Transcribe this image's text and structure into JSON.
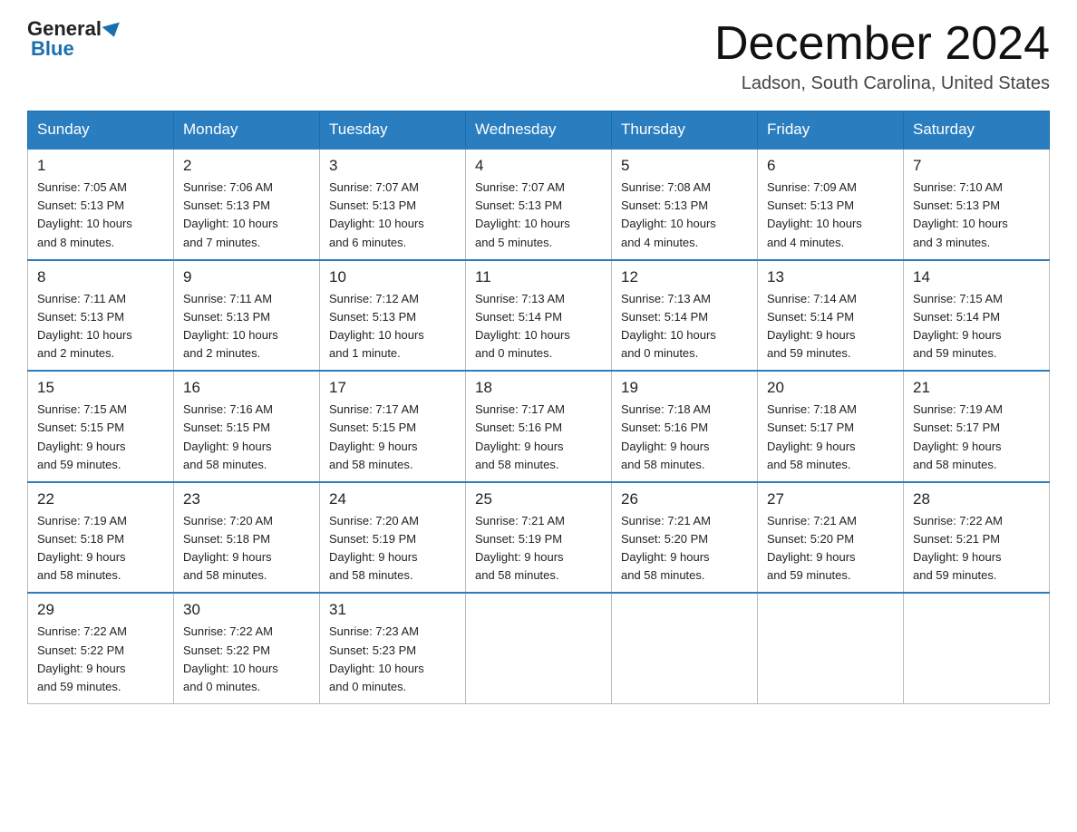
{
  "header": {
    "logo_general": "General",
    "logo_blue": "Blue",
    "month_title": "December 2024",
    "location": "Ladson, South Carolina, United States"
  },
  "days_of_week": [
    "Sunday",
    "Monday",
    "Tuesday",
    "Wednesday",
    "Thursday",
    "Friday",
    "Saturday"
  ],
  "weeks": [
    [
      {
        "day": "1",
        "sunrise": "7:05 AM",
        "sunset": "5:13 PM",
        "daylight": "10 hours and 8 minutes."
      },
      {
        "day": "2",
        "sunrise": "7:06 AM",
        "sunset": "5:13 PM",
        "daylight": "10 hours and 7 minutes."
      },
      {
        "day": "3",
        "sunrise": "7:07 AM",
        "sunset": "5:13 PM",
        "daylight": "10 hours and 6 minutes."
      },
      {
        "day": "4",
        "sunrise": "7:07 AM",
        "sunset": "5:13 PM",
        "daylight": "10 hours and 5 minutes."
      },
      {
        "day": "5",
        "sunrise": "7:08 AM",
        "sunset": "5:13 PM",
        "daylight": "10 hours and 4 minutes."
      },
      {
        "day": "6",
        "sunrise": "7:09 AM",
        "sunset": "5:13 PM",
        "daylight": "10 hours and 4 minutes."
      },
      {
        "day": "7",
        "sunrise": "7:10 AM",
        "sunset": "5:13 PM",
        "daylight": "10 hours and 3 minutes."
      }
    ],
    [
      {
        "day": "8",
        "sunrise": "7:11 AM",
        "sunset": "5:13 PM",
        "daylight": "10 hours and 2 minutes."
      },
      {
        "day": "9",
        "sunrise": "7:11 AM",
        "sunset": "5:13 PM",
        "daylight": "10 hours and 2 minutes."
      },
      {
        "day": "10",
        "sunrise": "7:12 AM",
        "sunset": "5:13 PM",
        "daylight": "10 hours and 1 minute."
      },
      {
        "day": "11",
        "sunrise": "7:13 AM",
        "sunset": "5:14 PM",
        "daylight": "10 hours and 0 minutes."
      },
      {
        "day": "12",
        "sunrise": "7:13 AM",
        "sunset": "5:14 PM",
        "daylight": "10 hours and 0 minutes."
      },
      {
        "day": "13",
        "sunrise": "7:14 AM",
        "sunset": "5:14 PM",
        "daylight": "9 hours and 59 minutes."
      },
      {
        "day": "14",
        "sunrise": "7:15 AM",
        "sunset": "5:14 PM",
        "daylight": "9 hours and 59 minutes."
      }
    ],
    [
      {
        "day": "15",
        "sunrise": "7:15 AM",
        "sunset": "5:15 PM",
        "daylight": "9 hours and 59 minutes."
      },
      {
        "day": "16",
        "sunrise": "7:16 AM",
        "sunset": "5:15 PM",
        "daylight": "9 hours and 58 minutes."
      },
      {
        "day": "17",
        "sunrise": "7:17 AM",
        "sunset": "5:15 PM",
        "daylight": "9 hours and 58 minutes."
      },
      {
        "day": "18",
        "sunrise": "7:17 AM",
        "sunset": "5:16 PM",
        "daylight": "9 hours and 58 minutes."
      },
      {
        "day": "19",
        "sunrise": "7:18 AM",
        "sunset": "5:16 PM",
        "daylight": "9 hours and 58 minutes."
      },
      {
        "day": "20",
        "sunrise": "7:18 AM",
        "sunset": "5:17 PM",
        "daylight": "9 hours and 58 minutes."
      },
      {
        "day": "21",
        "sunrise": "7:19 AM",
        "sunset": "5:17 PM",
        "daylight": "9 hours and 58 minutes."
      }
    ],
    [
      {
        "day": "22",
        "sunrise": "7:19 AM",
        "sunset": "5:18 PM",
        "daylight": "9 hours and 58 minutes."
      },
      {
        "day": "23",
        "sunrise": "7:20 AM",
        "sunset": "5:18 PM",
        "daylight": "9 hours and 58 minutes."
      },
      {
        "day": "24",
        "sunrise": "7:20 AM",
        "sunset": "5:19 PM",
        "daylight": "9 hours and 58 minutes."
      },
      {
        "day": "25",
        "sunrise": "7:21 AM",
        "sunset": "5:19 PM",
        "daylight": "9 hours and 58 minutes."
      },
      {
        "day": "26",
        "sunrise": "7:21 AM",
        "sunset": "5:20 PM",
        "daylight": "9 hours and 58 minutes."
      },
      {
        "day": "27",
        "sunrise": "7:21 AM",
        "sunset": "5:20 PM",
        "daylight": "9 hours and 59 minutes."
      },
      {
        "day": "28",
        "sunrise": "7:22 AM",
        "sunset": "5:21 PM",
        "daylight": "9 hours and 59 minutes."
      }
    ],
    [
      {
        "day": "29",
        "sunrise": "7:22 AM",
        "sunset": "5:22 PM",
        "daylight": "9 hours and 59 minutes."
      },
      {
        "day": "30",
        "sunrise": "7:22 AM",
        "sunset": "5:22 PM",
        "daylight": "10 hours and 0 minutes."
      },
      {
        "day": "31",
        "sunrise": "7:23 AM",
        "sunset": "5:23 PM",
        "daylight": "10 hours and 0 minutes."
      },
      null,
      null,
      null,
      null
    ]
  ],
  "labels": {
    "sunrise": "Sunrise:",
    "sunset": "Sunset:",
    "daylight": "Daylight:"
  }
}
